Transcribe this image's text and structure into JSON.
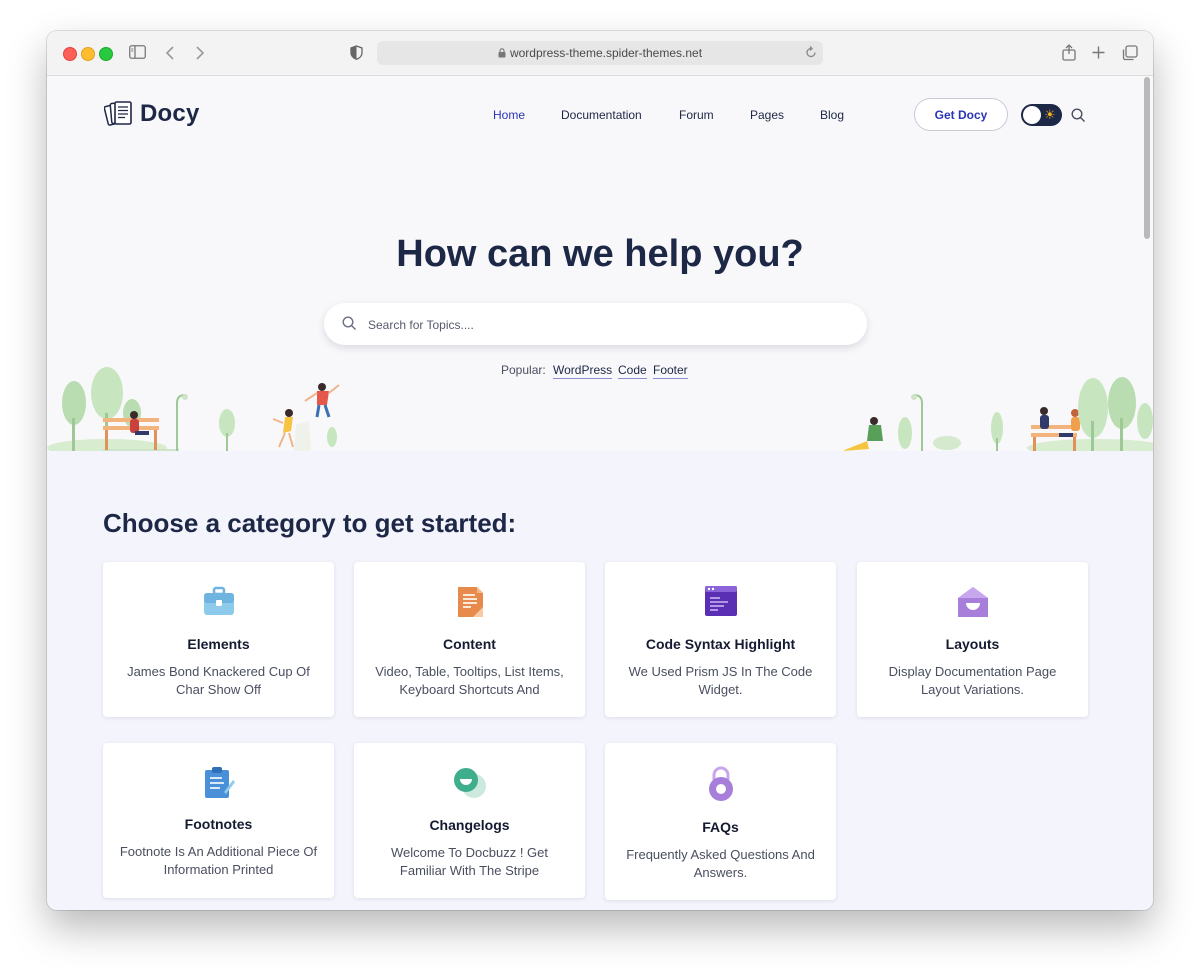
{
  "browser": {
    "url": "wordpress-theme.spider-themes.net"
  },
  "header": {
    "logo_text": "Docy",
    "nav": [
      "Home",
      "Documentation",
      "Forum",
      "Pages",
      "Blog"
    ],
    "cta_label": "Get Docy"
  },
  "hero": {
    "title": "How can we help you?",
    "search_placeholder": "Search for Topics....",
    "popular_label": "Popular:",
    "popular_tags": [
      "WordPress",
      "Code",
      "Footer"
    ]
  },
  "categories": {
    "heading": "Choose a category to get started:",
    "items": [
      {
        "title": "Elements",
        "desc": "James Bond Knackered Cup Of Char Show Off",
        "icon": "briefcase-icon"
      },
      {
        "title": "Content",
        "desc": "Video, Table, Tooltips, List Items, Keyboard Shortcuts And",
        "icon": "document-icon"
      },
      {
        "title": "Code Syntax Highlight",
        "desc": "We Used Prism JS In The Code Widget.",
        "icon": "code-window-icon"
      },
      {
        "title": "Layouts",
        "desc": "Display Documentation Page Layout Variations.",
        "icon": "house-icon"
      },
      {
        "title": "Footnotes",
        "desc": "Footnote Is An Additional Piece Of Information Printed",
        "icon": "clipboard-icon"
      },
      {
        "title": "Changelogs",
        "desc": "Welcome To Docbuzz ! Get Familiar With The Stripe",
        "icon": "chat-bubble-icon"
      },
      {
        "title": "FAQs",
        "desc": "Frequently Asked Questions And Answers.",
        "icon": "lock-icon"
      }
    ]
  },
  "colors": {
    "brand_dark": "#1d2746",
    "accent_blue": "#2a35b5",
    "section_bg": "#f4f4fc"
  }
}
